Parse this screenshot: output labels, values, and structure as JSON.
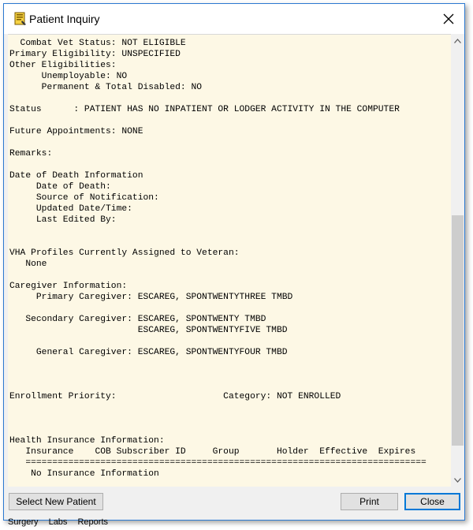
{
  "window": {
    "title": "Patient Inquiry",
    "report_text": "  Combat Vet Status: NOT ELIGIBLE\nPrimary Eligibility: UNSPECIFIED\nOther Eligibilities:\n      Unemployable: NO\n      Permanent & Total Disabled: NO\n\nStatus      : PATIENT HAS NO INPATIENT OR LODGER ACTIVITY IN THE COMPUTER\n\nFuture Appointments: NONE\n\nRemarks:\n\nDate of Death Information\n     Date of Death:\n     Source of Notification:\n     Updated Date/Time:\n     Last Edited By:\n\n\nVHA Profiles Currently Assigned to Veteran:\n   None\n\nCaregiver Information:\n     Primary Caregiver: ESCAREG, SPONTWENTYTHREE TMBD\n\n   Secondary Caregiver: ESCAREG, SPONTWENTY TMBD\n                        ESCAREG, SPONTWENTYFIVE TMBD\n\n     General Caregiver: ESCAREG, SPONTWENTYFOUR TMBD\n\n\n\nEnrollment Priority:                    Category: NOT ENROLLED\n\n\n\nHealth Insurance Information:\n   Insurance    COB Subscriber ID     Group       Holder  Effective  Expires\n   ===========================================================================\n    No Insurance Information"
  },
  "buttons": {
    "select_new_patient": "Select New Patient",
    "print": "Print",
    "close": "Close"
  },
  "background_tabs": "Surgery Labs Reports",
  "icons": {
    "app": "patient-inquiry-icon",
    "close": "close-icon",
    "scroll_up": "chevron-up-icon",
    "scroll_down": "chevron-down-icon"
  },
  "colors": {
    "content_background": "#fdf8e5",
    "window_border": "#2b79d1",
    "focus_border": "#0078d7"
  }
}
